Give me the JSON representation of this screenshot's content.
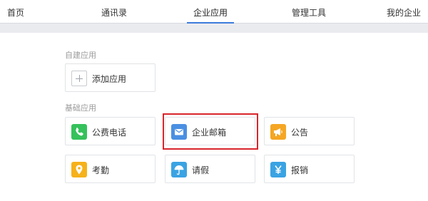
{
  "nav": {
    "tabs": [
      {
        "label": "首页"
      },
      {
        "label": "通讯录"
      },
      {
        "label": "企业应用"
      },
      {
        "label": "管理工具"
      },
      {
        "label": "我的企业"
      }
    ],
    "active_tab": "企业应用"
  },
  "sections": {
    "custom": {
      "title": "自建应用",
      "add_label": "添加应用"
    },
    "basic": {
      "title": "基础应用",
      "apps": [
        {
          "label": "公费电话",
          "icon": "phone-icon",
          "color": "#35c15b"
        },
        {
          "label": "企业邮箱",
          "icon": "mail-icon",
          "color": "#4a90e2"
        },
        {
          "label": "公告",
          "icon": "megaphone-icon",
          "color": "#f5a623"
        },
        {
          "label": "考勤",
          "icon": "location-pin-icon",
          "color": "#f6b21a"
        },
        {
          "label": "请假",
          "icon": "umbrella-icon",
          "color": "#3aa3e3"
        },
        {
          "label": "报销",
          "icon": "yen-icon",
          "color": "#3aa3e3"
        }
      ]
    }
  },
  "highlight_color": "#d9252c",
  "accent_color": "#3d7bdc"
}
